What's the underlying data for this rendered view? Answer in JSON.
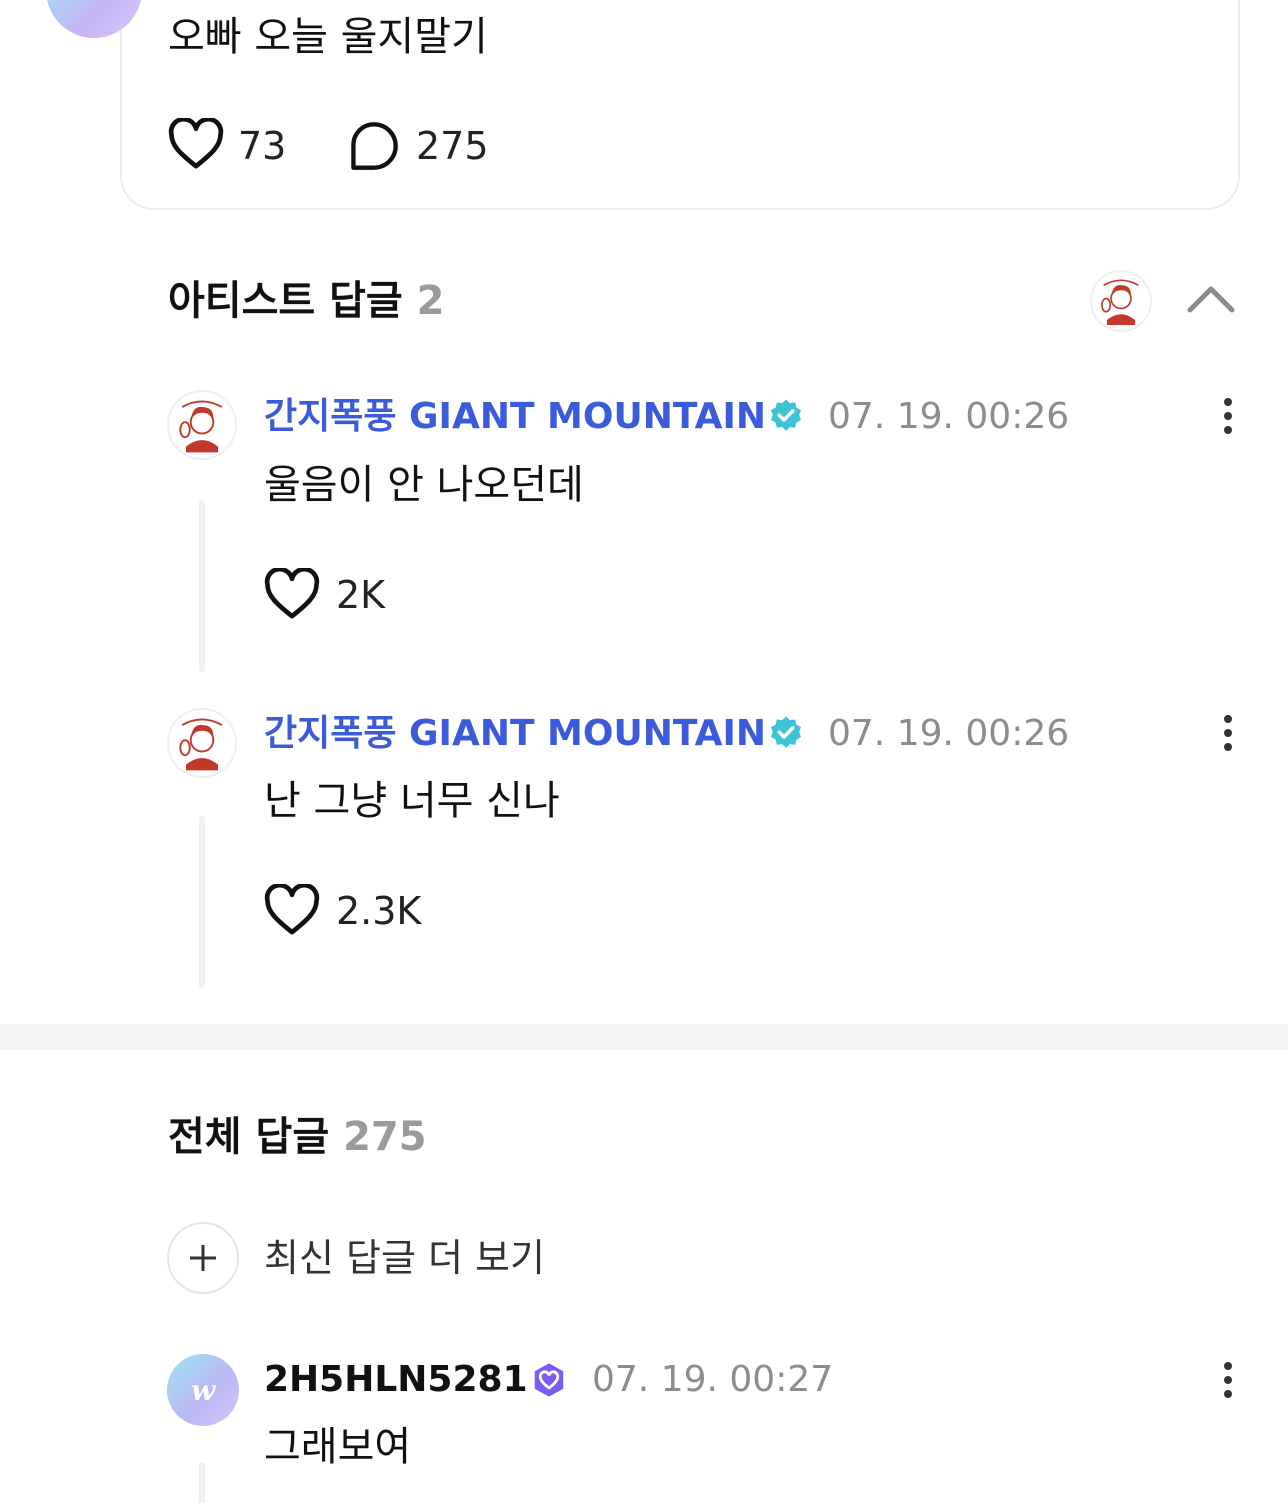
{
  "post": {
    "text": "오빠 오늘 울지말기",
    "likes": "73",
    "replies": "275"
  },
  "artist_section": {
    "title": "아티스트 답글",
    "count": "2"
  },
  "artist_replies": [
    {
      "name": "간지폭풍 GIANT MOUNTAIN",
      "time": "07. 19. 00:26",
      "text": "울음이 안 나오던데",
      "likes": "2K"
    },
    {
      "name": "간지폭풍 GIANT MOUNTAIN",
      "time": "07. 19. 00:26",
      "text": "난 그냥 너무 신나",
      "likes": "2.3K"
    }
  ],
  "all_section": {
    "title": "전체 답글",
    "count": "275",
    "more_label": "최신 답글 더 보기"
  },
  "user_replies": [
    {
      "name": "2H5HLN5281",
      "time": "07. 19. 00:27",
      "text": "그래보여",
      "avatar_letter": "w"
    }
  ],
  "colors": {
    "artist_name": "#3b5bdb",
    "verified_badge": "#3cc3d6",
    "user_badge": "#7c5cf0",
    "muted": "#8c8c8c"
  }
}
